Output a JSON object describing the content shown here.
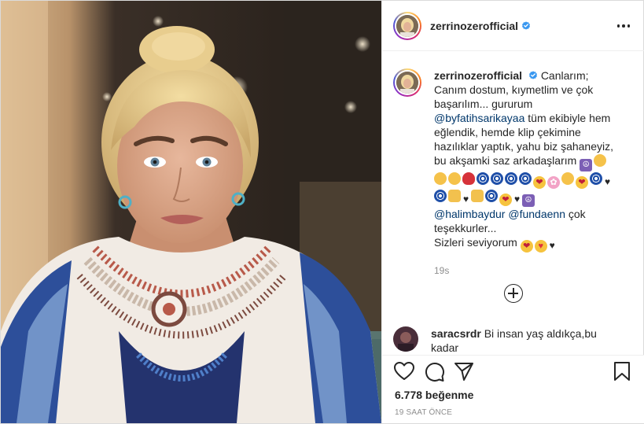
{
  "post": {
    "username": "zerrinozerofficial",
    "verified": true,
    "caption": {
      "username": "zerrinozerofficial",
      "line1": "Canlarım;",
      "line2": "Canım dostum, kıymetlim ve çok başarılım... gururum",
      "mention1": "@byfatihsarikayaa",
      "line3": "tüm ekibiyle hem eğlendik, hemde klip çekimine hazılıklar yaptık, yahu biz şahaneyiz, bu akşamki saz arkadaşlarım",
      "mention2": "@halimbaydur",
      "mention3": "@fundaenn",
      "line4": "çok teşekkurler...",
      "line5": "Sizleri seviyorum",
      "time_ago": "19s"
    },
    "comment": {
      "username": "saracsrdr",
      "text": "Bi insan yaş aldıkça,bu kadar"
    },
    "likes_label": "6.778 beğenme",
    "timestamp": "19 SAAT ÖNCE"
  },
  "icons": {
    "like": "heart-icon",
    "comment": "comment-icon",
    "share": "paper-plane-icon",
    "save": "bookmark-icon",
    "more": "more-options-icon",
    "load_more": "plus-circle-icon",
    "verified": "verified-badge-icon"
  },
  "colors": {
    "verified": "#3897f0",
    "mention": "#00376b",
    "muted": "#8e8e8e",
    "text": "#262626"
  }
}
